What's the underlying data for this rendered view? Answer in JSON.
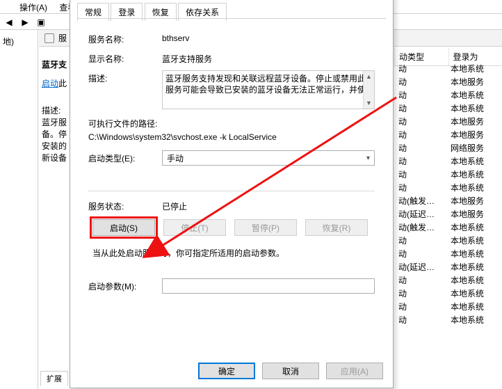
{
  "menu": {
    "action": "操作(A)",
    "view": "查看("
  },
  "left_local": "地)",
  "services_header": "服",
  "left_panel": {
    "title": "蓝牙支",
    "start_link": "启动",
    "start_suffix": "此",
    "desc_label": "描述:",
    "desc_lines": [
      "蓝牙服",
      "备。停",
      "安装的",
      "新设备"
    ]
  },
  "columns": {
    "startup": "动类型",
    "logon": "登录为"
  },
  "rows": [
    {
      "s": "动",
      "l": "本地系统"
    },
    {
      "s": "动",
      "l": "本地服务"
    },
    {
      "s": "动",
      "l": "本地系统"
    },
    {
      "s": "动",
      "l": "本地系统"
    },
    {
      "s": "动",
      "l": "本地服务"
    },
    {
      "s": "动",
      "l": "本地服务"
    },
    {
      "s": "动",
      "l": "网络服务"
    },
    {
      "s": "动",
      "l": "本地系统"
    },
    {
      "s": "动",
      "l": "本地系统"
    },
    {
      "s": "动",
      "l": "本地系统"
    },
    {
      "s": "动(触发…",
      "l": "本地服务"
    },
    {
      "s": "动(延迟…",
      "l": "本地服务"
    },
    {
      "s": "动(触发…",
      "l": "本地系统"
    },
    {
      "s": "动",
      "l": "本地系统"
    },
    {
      "s": "动",
      "l": "本地系统"
    },
    {
      "s": "动(延迟…",
      "l": "本地系统"
    },
    {
      "s": "动",
      "l": "本地系统"
    },
    {
      "s": "动",
      "l": "本地系统"
    },
    {
      "s": "动",
      "l": "本地系统"
    },
    {
      "s": "动",
      "l": "本地系统"
    }
  ],
  "extended_tab": "扩展",
  "dialog": {
    "tabs": {
      "general": "常规",
      "logon": "登录",
      "recovery": "恢复",
      "deps": "依存关系"
    },
    "service_name_label": "服务名称:",
    "service_name": "bthserv",
    "display_name_label": "显示名称:",
    "display_name": "蓝牙支持服务",
    "description_label": "描述:",
    "description": "蓝牙服务支持发现和关联远程蓝牙设备。停止或禁用此服务可能会导致已安装的蓝牙设备无法正常运行，并使",
    "exe_path_label": "可执行文件的路径:",
    "exe_path": "C:\\Windows\\system32\\svchost.exe -k LocalService",
    "startup_type_label": "启动类型(E):",
    "startup_type": "手动",
    "status_label": "服务状态:",
    "status": "已停止",
    "start_btn": "启动(S)",
    "stop_btn": "停止(T)",
    "pause_btn": "暂停(P)",
    "resume_btn": "恢复(R)",
    "note": "当从此处启动服务时，你可指定所适用的启动参数。",
    "param_label": "启动参数(M):",
    "ok": "确定",
    "cancel": "取消",
    "apply": "应用(A)"
  }
}
